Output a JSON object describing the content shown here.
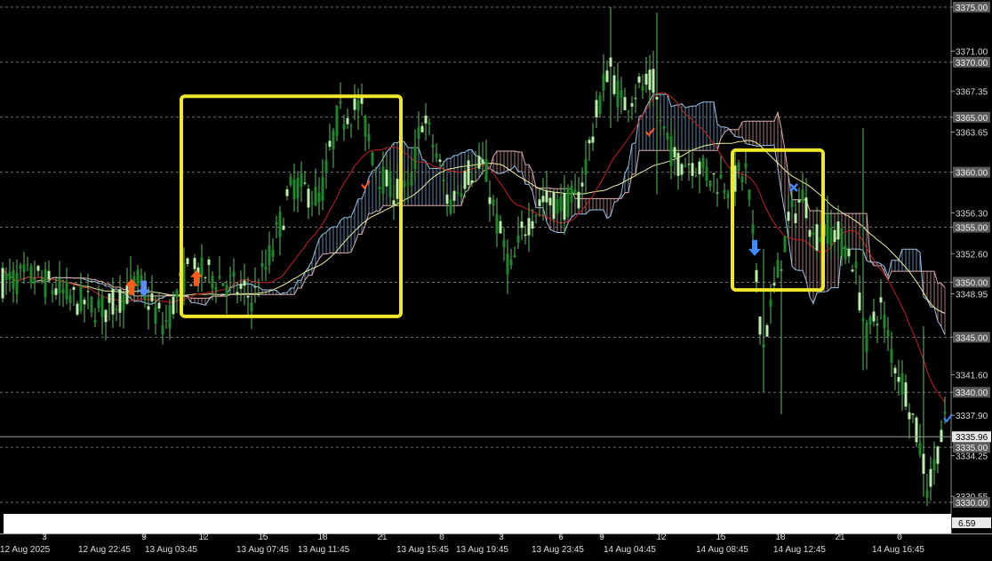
{
  "chart_data": {
    "type": "candlestick",
    "instrument_hint": "XAUUSD (gold) price chart with Ichimoku cloud and moving averages",
    "ylim": [
      3329.0,
      3375.4
    ],
    "price_ticks": [
      {
        "value": 3375.0,
        "label": "3375.00",
        "level": true
      },
      {
        "value": 3371.0,
        "label": "3371.00",
        "level": false
      },
      {
        "value": 3370.0,
        "label": "3370.00",
        "level": true
      },
      {
        "value": 3367.35,
        "label": "3367.35",
        "level": false
      },
      {
        "value": 3365.0,
        "label": "3365.00",
        "level": true
      },
      {
        "value": 3363.65,
        "label": "3363.65",
        "level": false
      },
      {
        "value": 3360.0,
        "label": "3360.00",
        "level": true
      },
      {
        "value": 3356.3,
        "label": "3356.30",
        "level": false
      },
      {
        "value": 3355.0,
        "label": "3355.00",
        "level": true
      },
      {
        "value": 3352.6,
        "label": "3352.60",
        "level": false
      },
      {
        "value": 3350.0,
        "label": "3350.00",
        "level": true
      },
      {
        "value": 3348.95,
        "label": "3348.95",
        "level": false
      },
      {
        "value": 3345.0,
        "label": "3345.00",
        "level": true
      },
      {
        "value": 3341.6,
        "label": "3341.60",
        "level": false
      },
      {
        "value": 3340.0,
        "label": "3340.00",
        "level": true
      },
      {
        "value": 3337.9,
        "label": "3337.90",
        "level": false
      },
      {
        "value": 3335.0,
        "label": "3335.00",
        "level": true
      },
      {
        "value": 3334.25,
        "label": "3334.25",
        "level": false
      },
      {
        "value": 3330.55,
        "label": "3330.55",
        "level": false
      },
      {
        "value": 3330.0,
        "label": "3330.00",
        "level": true
      }
    ],
    "current_price": {
      "value": 3335.96,
      "label": "3335.96"
    },
    "bottom_tick_label": "6.59",
    "hour_labels": [
      "3",
      "9",
      "12",
      "15",
      "18",
      "21",
      "0",
      "3",
      "6",
      "9",
      "12",
      "15",
      "18",
      "21",
      "0"
    ],
    "date_labels": [
      "12 Aug 2025",
      "12 Aug 22:45",
      "13 Aug 03:45",
      "13 Aug 07:45",
      "13 Aug 11:45",
      "13 Aug 15:45",
      "13 Aug 19:45",
      "13 Aug 23:45",
      "14 Aug 04:45",
      "14 Aug 08:45",
      "14 Aug 12:45",
      "14 Aug 16:45"
    ],
    "series": [
      {
        "name": "",
        "color": "#f0f0a0"
      },
      {
        "name": "",
        "color": "#c81e1e"
      }
    ],
    "price_path": [
      [
        0,
        3350
      ],
      [
        40,
        3350.5
      ],
      [
        80,
        3348.5
      ],
      [
        120,
        3347.5
      ],
      [
        155,
        3350
      ],
      [
        185,
        3346
      ],
      [
        210,
        3351
      ],
      [
        245,
        3350.5
      ],
      [
        285,
        3348.5
      ],
      [
        300,
        3351.5
      ],
      [
        330,
        3359
      ],
      [
        360,
        3357.5
      ],
      [
        380,
        3365
      ],
      [
        405,
        3366
      ],
      [
        425,
        3360
      ],
      [
        440,
        3358.5
      ],
      [
        460,
        3358
      ],
      [
        475,
        3365
      ],
      [
        490,
        3362
      ],
      [
        505,
        3357
      ],
      [
        525,
        3360
      ],
      [
        545,
        3360.5
      ],
      [
        560,
        3355
      ],
      [
        575,
        3351
      ],
      [
        590,
        3355
      ],
      [
        610,
        3357.5
      ],
      [
        630,
        3357
      ],
      [
        650,
        3357.5
      ],
      [
        665,
        3363
      ],
      [
        685,
        3370
      ],
      [
        700,
        3366
      ],
      [
        715,
        3367.5
      ],
      [
        735,
        3368
      ],
      [
        745,
        3364
      ],
      [
        760,
        3361
      ],
      [
        780,
        3361
      ],
      [
        800,
        3359.5
      ],
      [
        820,
        3359
      ],
      [
        840,
        3360
      ],
      [
        848,
        3353
      ],
      [
        858,
        3344
      ],
      [
        868,
        3348
      ],
      [
        878,
        3352
      ],
      [
        890,
        3356
      ],
      [
        905,
        3358
      ],
      [
        915,
        3354
      ],
      [
        930,
        3355
      ],
      [
        945,
        3354
      ],
      [
        960,
        3352
      ],
      [
        975,
        3345
      ],
      [
        990,
        3348
      ],
      [
        1005,
        3343
      ],
      [
        1020,
        3340
      ],
      [
        1035,
        3335
      ],
      [
        1045,
        3331
      ],
      [
        1055,
        3335
      ],
      [
        1068,
        3338
      ]
    ],
    "annotation_boxes": [
      {
        "from_x": "13 Aug ~01:00",
        "to_x": "13 Aug ~16:00",
        "from_y": 3346.9,
        "to_y": 3366.9,
        "color": "#f0e62a"
      },
      {
        "from_x": "14 Aug ~08:00",
        "to_x": "14 Aug ~12:00",
        "from_y": 3349.3,
        "to_y": 3362.0,
        "color": "#f0e62a"
      }
    ],
    "signals": [
      {
        "type": "buy-arrow",
        "color": "#ff5a1e"
      },
      {
        "type": "sell-arrow",
        "color": "#5a8cff"
      },
      {
        "type": "buy-arrow",
        "color": "#ff5a1e"
      },
      {
        "type": "check",
        "color": "#ff5a1e"
      },
      {
        "type": "check",
        "color": "#ff5a1e"
      },
      {
        "type": "sell-arrow",
        "color": "#3c8cff"
      },
      {
        "type": "cross",
        "color": "#3c8cff"
      },
      {
        "type": "check",
        "color": "#3c8cff"
      }
    ]
  }
}
